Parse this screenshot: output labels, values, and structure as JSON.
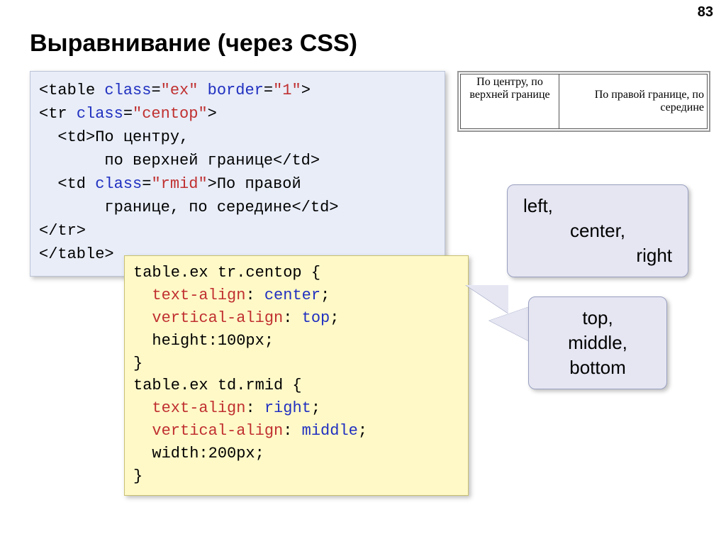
{
  "page_number": "83",
  "title": "Выравнивание (через CSS)",
  "html_code": {
    "l1a": "<table ",
    "l1b": "class",
    "l1c": "=",
    "l1d": "\"ex\"",
    "l1e": " ",
    "l1f": "border",
    "l1g": "=",
    "l1h": "\"1\"",
    "l1i": ">",
    "l2a": "<tr ",
    "l2b": "class",
    "l2c": "=",
    "l2d": "\"centop\"",
    "l2e": ">",
    "l3": "  <td>По центру,",
    "l4": "       по верхней границе</td>",
    "l5a": "  <td ",
    "l5b": "class",
    "l5c": "=",
    "l5d": "\"rmid\"",
    "l5e": ">По правой",
    "l6": "       границе, по середине</td>",
    "l7": "</tr>",
    "l8": "</table>"
  },
  "css_code": {
    "l1": "table.ex tr.centop {",
    "l2a": "  ",
    "l2b": "text-align",
    "l2c": ": ",
    "l2d": "center",
    "l2e": ";",
    "l3a": "  ",
    "l3b": "vertical-align",
    "l3c": ": ",
    "l3d": "top",
    "l3e": ";",
    "l4": "  height:100px;",
    "l5": "}",
    "l6": "table.ex td.rmid {",
    "l7a": "  ",
    "l7b": "text-align",
    "l7c": ": ",
    "l7d": "right",
    "l7e": ";",
    "l8a": "  ",
    "l8b": "vertical-align",
    "l8c": ": ",
    "l8d": "middle",
    "l8e": ";",
    "l9": "  width:200px;",
    "l10": "}"
  },
  "preview": {
    "cell1": "По центру, по верхней границе",
    "cell2": "По правой границе, по середине"
  },
  "callout1": {
    "l1": "left,",
    "l2": "center,",
    "l3": "right"
  },
  "callout2": {
    "l1": "top,",
    "l2": "middle,",
    "l3": "bottom"
  }
}
